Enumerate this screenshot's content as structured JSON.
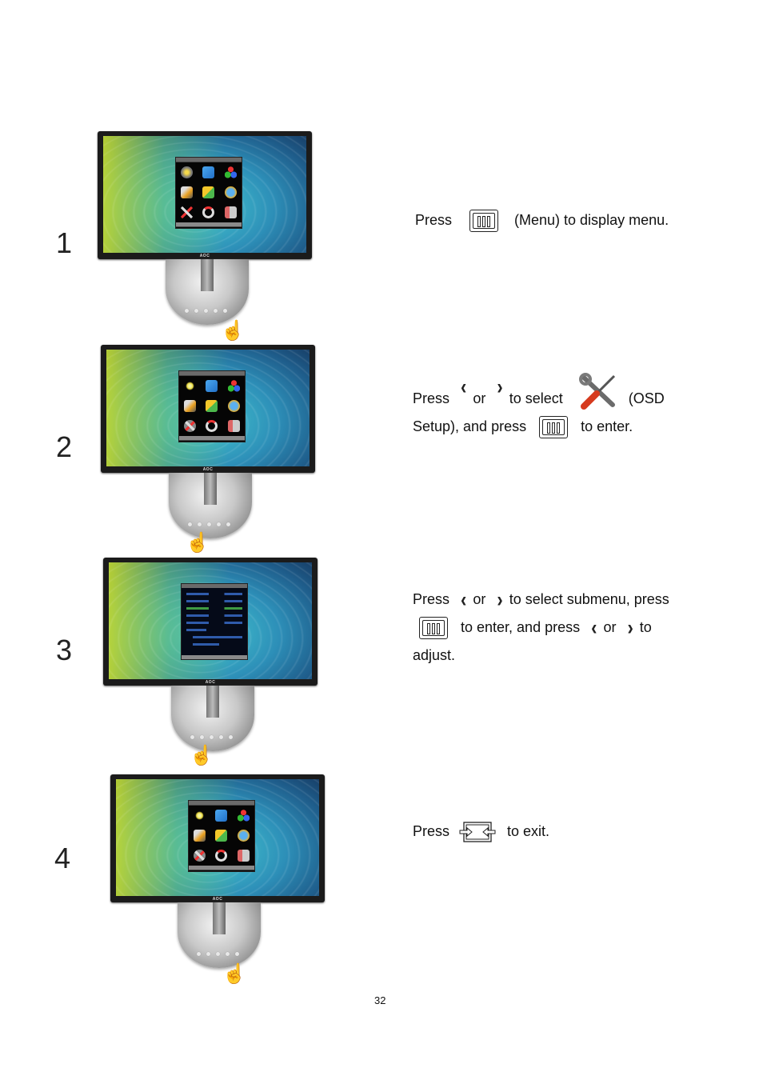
{
  "page_number": "32",
  "steps": [
    {
      "number": "1",
      "screen": "osd-main-menu",
      "instruction": {
        "line1": {
          "press": "Press",
          "button": "menu-button-icon",
          "text": "(Menu) to display menu."
        }
      }
    },
    {
      "number": "2",
      "screen": "osd-main-menu-osd-setup-highlighted",
      "instruction": {
        "line1": {
          "press": "Press",
          "left": "left-arrow-icon",
          "or": "or",
          "right": "right-arrow-icon",
          "to_select": "to select",
          "icon": "osd-setup-icon",
          "label": "(OSD"
        },
        "line2": {
          "text": "Setup), and press",
          "button": "menu-button-icon",
          "tail": "to enter."
        }
      }
    },
    {
      "number": "3",
      "screen": "osd-setup-submenu",
      "instruction": {
        "line1": {
          "press": "Press",
          "left": "left-arrow-icon",
          "or": "or",
          "right": "right-arrow-icon",
          "tail": "to select submenu, press"
        },
        "line2": {
          "button": "menu-button-icon",
          "text": "to enter, and press",
          "left": "left-arrow-icon",
          "or": "or",
          "right": "right-arrow-icon",
          "tail": "to"
        },
        "line3": {
          "text": "adjust."
        }
      }
    },
    {
      "number": "4",
      "screen": "osd-main-menu",
      "instruction": {
        "line1": {
          "press": "Press",
          "button": "auto-exit-button-icon",
          "tail": "to exit."
        }
      }
    }
  ],
  "glyphs": {
    "left_arrow": "‹",
    "right_arrow": "›",
    "pointer_hand": "☝"
  },
  "monitor_brand": "AOC"
}
